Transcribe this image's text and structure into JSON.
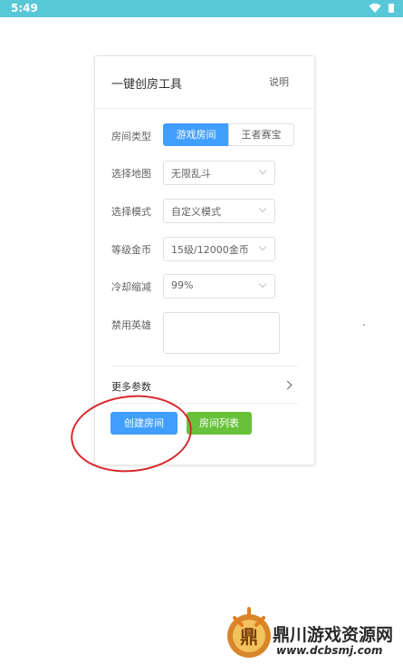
{
  "status_bar": {
    "time": "5:49"
  },
  "card": {
    "title": "一键创房工具",
    "help_label": "说明",
    "rows": {
      "room_type": {
        "label": "房间类型",
        "options": [
          "游戏房间",
          "王者赛宝"
        ],
        "selected": "游戏房间"
      },
      "map": {
        "label": "选择地图",
        "value": "无限乱斗"
      },
      "mode": {
        "label": "选择模式",
        "value": "自定义模式"
      },
      "level_gold": {
        "label": "等级金币",
        "value": "15级/12000金币"
      },
      "cooldown": {
        "label": "冷却缩减",
        "value": "99%"
      },
      "banned_heroes": {
        "label": "禁用英雄",
        "value": ""
      }
    },
    "more_params_label": "更多参数",
    "buttons": {
      "create_room": "创建房间",
      "room_list": "房间列表"
    }
  },
  "annotation": {
    "circle_color": "#d8282c"
  },
  "watermark": {
    "logo_text": "鼎",
    "title": "鼎川游戏资源网",
    "url": "www.dcbsmj.com"
  },
  "colors": {
    "status_bar": "#58c8d8",
    "primary": "#409eff",
    "success": "#67c23a"
  }
}
